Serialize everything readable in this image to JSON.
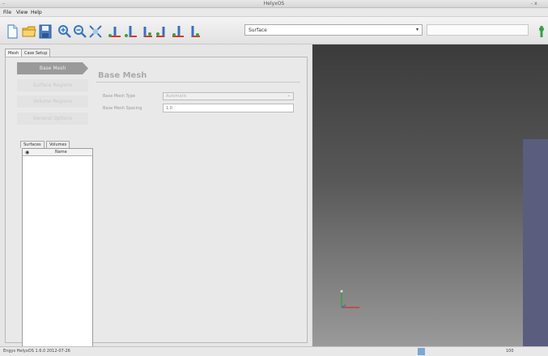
{
  "window": {
    "title": "HelyxOS",
    "controls": "-  x"
  },
  "menu": [
    "File",
    "View",
    "Help"
  ],
  "toolbar": {
    "icons": [
      "new-file-icon",
      "open-folder-icon",
      "save-icon",
      "zoom-in-icon",
      "zoom-out-icon",
      "fit-view-icon",
      "view-x-icon",
      "view-y-icon",
      "view-z-icon",
      "view-x2-icon",
      "view-iso-icon",
      "view-iso2-icon"
    ],
    "surface_select": "Surface"
  },
  "tabs": [
    "Mesh",
    "Case Setup"
  ],
  "nav": [
    "Base Mesh",
    "Surface Regions",
    "Volume Regions",
    "General Options"
  ],
  "section": {
    "title": "Base Mesh",
    "mesh_type_label": "Base Mesh Type",
    "mesh_type_value": "Automatic",
    "spacing_label": "Base Mesh Spacing",
    "spacing_value": "1.0"
  },
  "subtabs": [
    "Surfaces",
    "Volumes"
  ],
  "list": {
    "name_header": "Name"
  },
  "status": {
    "message": "Engys HelyxOS 1.6.0 2012-07-26",
    "percent": "100"
  }
}
